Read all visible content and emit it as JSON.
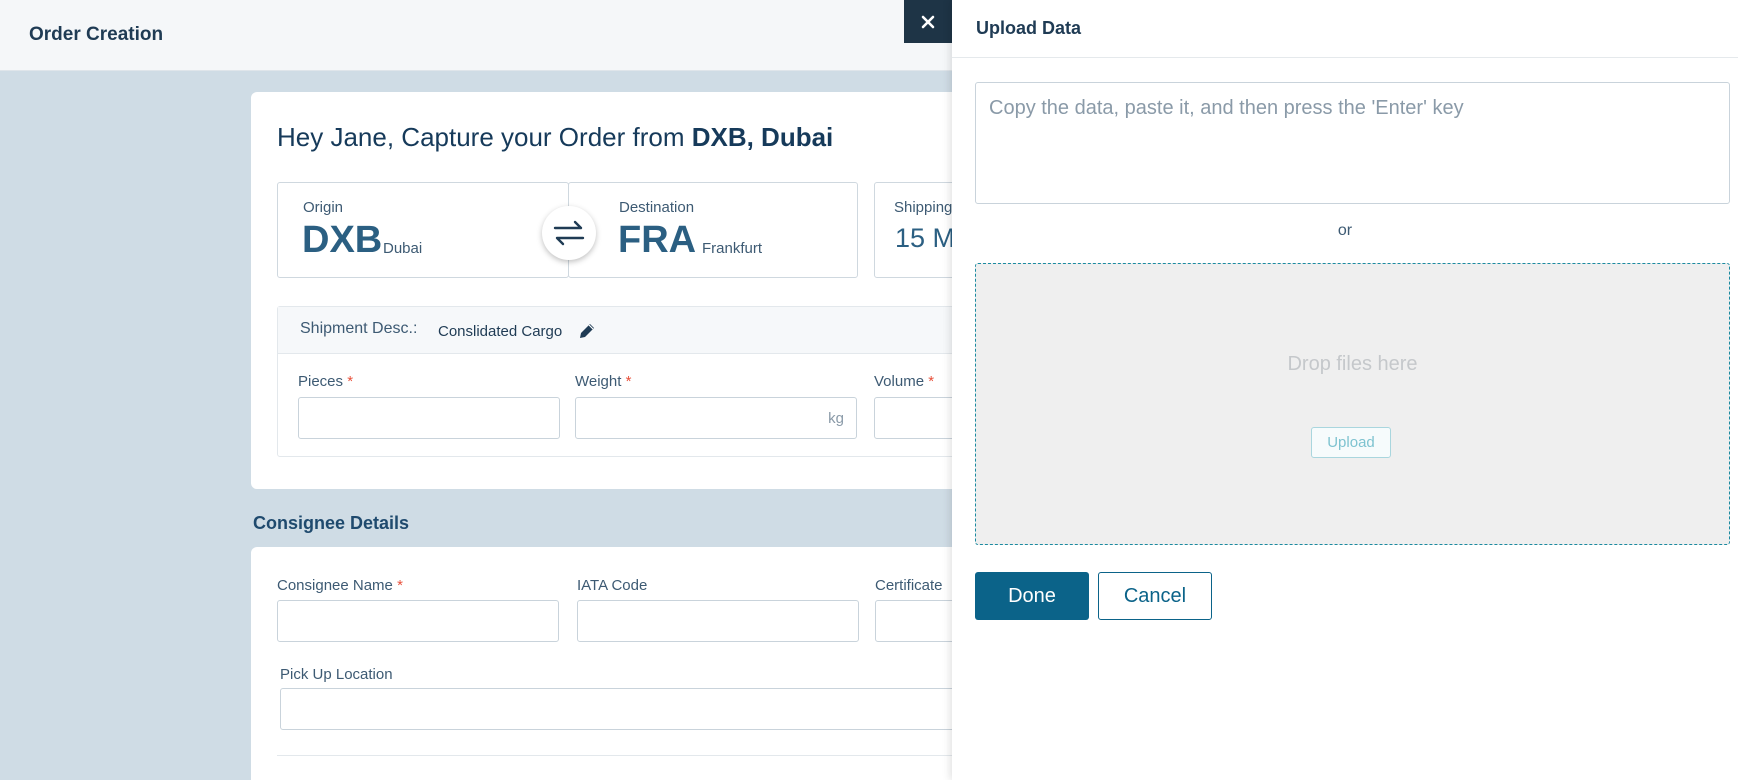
{
  "header": {
    "title": "Order Creation"
  },
  "order": {
    "greeting_prefix": "Hey Jane, Capture your Order from ",
    "greeting_station": "DXB, Dubai",
    "origin": {
      "label": "Origin",
      "code": "DXB",
      "city": "Dubai"
    },
    "destination": {
      "label": "Destination",
      "code": "FRA",
      "city": "Frankfurt"
    },
    "shipping": {
      "label": "Shipping",
      "value": "15 M"
    },
    "shipment_desc": {
      "label": "Shipment Desc.:",
      "value": "Conslidated Cargo"
    },
    "fields": {
      "pieces": "Pieces",
      "weight": "Weight",
      "weight_unit": "kg",
      "volume": "Volume",
      "required_mark": "*"
    }
  },
  "consignee": {
    "section_title": "Consignee Details",
    "name_label": "Consignee Name",
    "iata_label": "IATA Code",
    "certificate_label": "Certificate",
    "pickup_label": "Pick Up Location"
  },
  "upload_panel": {
    "title": "Upload Data",
    "paste_placeholder": "Copy the data, paste it, and then press the 'Enter' key",
    "or_text": "or",
    "drop_text": "Drop files here",
    "upload_label": "Upload",
    "done_label": "Done",
    "cancel_label": "Cancel"
  },
  "icons": {
    "close": "close-icon",
    "swap": "swap-arrows-icon",
    "edit": "pencil-icon"
  },
  "colors": {
    "primary": "#0b6389",
    "heading": "#1f3b54",
    "required": "#e8503a",
    "background": "#cfdce5"
  }
}
